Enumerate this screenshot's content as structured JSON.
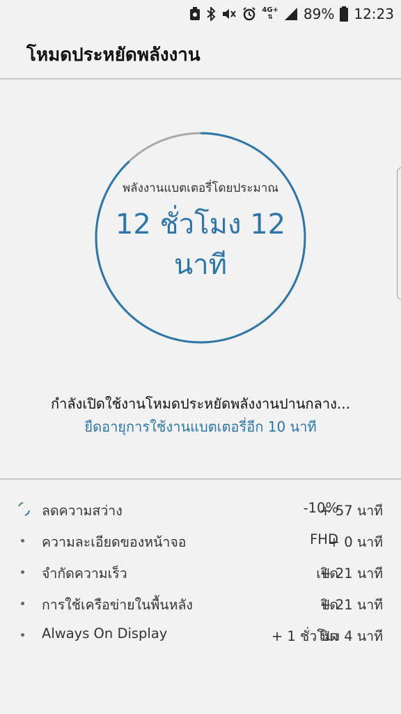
{
  "status_bar": {
    "icons": [
      "screenshot-icon",
      "bluetooth-icon",
      "mute-icon",
      "alarm-icon",
      "network-4g-icon",
      "signal-icon",
      "battery-icon"
    ],
    "network_type": "4G+",
    "battery": "89%",
    "time": "12:23"
  },
  "header": {
    "title": "โหมดประหยัดพลังงาน"
  },
  "estimate": {
    "label": "พลังงานแบตเตอรี่โดยประมาณ",
    "value": "12 ชั่วโมง 12 นาที",
    "ring_fill_fraction": 0.88
  },
  "mode": {
    "status_text": "กำลังเปิดใช้งานโหมดประหยัดพลังงานปานกลาง...",
    "extend_text": "ยืดอายุการใช้งานแบตเตอรี่อีก 10 นาที"
  },
  "savings": [
    {
      "label": "ลดความสว่าง",
      "value": "-10%",
      "time": "+ 57 นาที",
      "in_progress": true
    },
    {
      "label": "ความละเอียดของหน้าจอ",
      "value": "FHD",
      "time": "+ 0 นาที",
      "in_progress": false
    },
    {
      "label": "จำกัดความเร็ว",
      "value": "เปิด",
      "time": "+ 21 นาที",
      "in_progress": false
    },
    {
      "label": "การใช้เครือข่ายในพื้นหลัง",
      "value": "ปิด",
      "time": "+ 21 นาที",
      "in_progress": false
    },
    {
      "label": "Always On Display",
      "value": "ปิด",
      "time": "+ 1 ชั่วโมง 4 นาที",
      "in_progress": false
    }
  ],
  "colors": {
    "accent": "#2e76a8",
    "ring_track": "#a8a8a8",
    "background": "#f2f2f2"
  }
}
